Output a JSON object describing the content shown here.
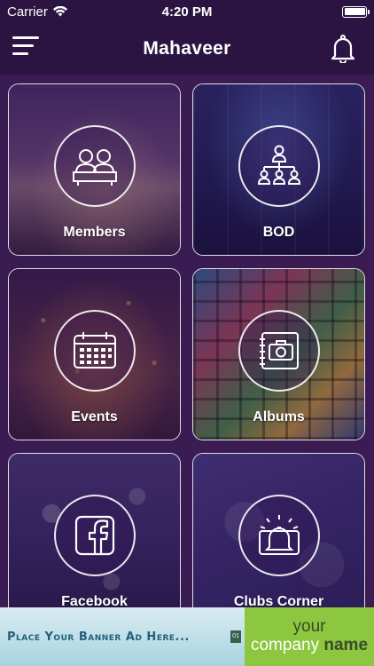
{
  "status_bar": {
    "carrier": "Carrier",
    "time": "4:20 PM"
  },
  "header": {
    "title": "Mahaveer"
  },
  "tiles": [
    {
      "label": "Members",
      "icon": "members-icon"
    },
    {
      "label": "BOD",
      "icon": "org-chart-icon"
    },
    {
      "label": "Events",
      "icon": "calendar-icon"
    },
    {
      "label": "Albums",
      "icon": "camera-icon"
    },
    {
      "label": "Facebook",
      "icon": "facebook-icon"
    },
    {
      "label": "Clubs Corner",
      "icon": "alarm-bell-icon"
    }
  ],
  "banner": {
    "left_text": "Place Your Banner Ad Here...",
    "badge": "01",
    "right_line1": "your",
    "right_line2a": "company",
    "right_line2b": "name"
  },
  "colors": {
    "header_bg": "#2c1442",
    "page_bg": "#3a1c52",
    "banner_green": "#8dc63f",
    "banner_blue": "#a9d3e0"
  }
}
